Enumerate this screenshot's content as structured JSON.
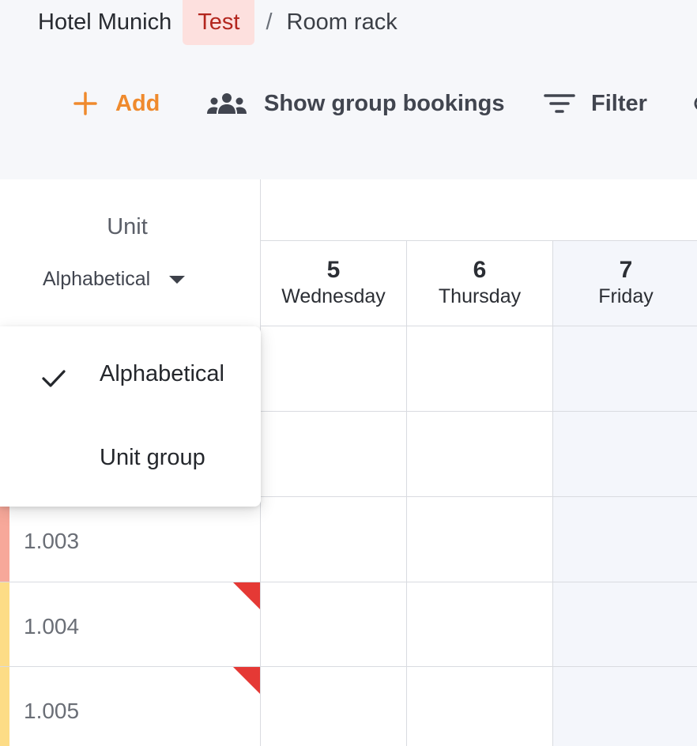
{
  "breadcrumb": {
    "hotel": "Hotel Munich",
    "environment": "Test",
    "separator": "/",
    "page": "Room rack"
  },
  "toolbar": {
    "add_label": "Add",
    "group_bookings_label": "Show group bookings",
    "filter_label": "Filter",
    "icons": [
      "plus-icon",
      "group-icon",
      "filter-icon"
    ]
  },
  "unit_header": {
    "title": "Unit",
    "sort_value": "Alphabetical"
  },
  "sort_menu": {
    "options": [
      {
        "label": "Alphabetical",
        "selected": true
      },
      {
        "label": "Unit group",
        "selected": false
      }
    ]
  },
  "dates": [
    {
      "number": "5",
      "day": "Wednesday",
      "weekend": false
    },
    {
      "number": "6",
      "day": "Thursday",
      "weekend": false
    },
    {
      "number": "7",
      "day": "Friday",
      "weekend": true
    }
  ],
  "units": [
    {
      "label": "",
      "status_color": "#ffffff",
      "flag": false
    },
    {
      "label": "",
      "status_color": "#ffffff",
      "flag": false
    },
    {
      "label": "1.003",
      "status_color": "#f7a89a",
      "flag": false
    },
    {
      "label": "1.004",
      "status_color": "#fddc86",
      "flag": true
    },
    {
      "label": "1.005",
      "status_color": "#fddc86",
      "flag": true
    }
  ],
  "colors": {
    "accent": "#ef8a2d",
    "env_badge_bg": "#fde0de",
    "env_badge_text": "#b3261e",
    "flag": "#e53935",
    "weekend_bg": "#f4f6fb"
  }
}
